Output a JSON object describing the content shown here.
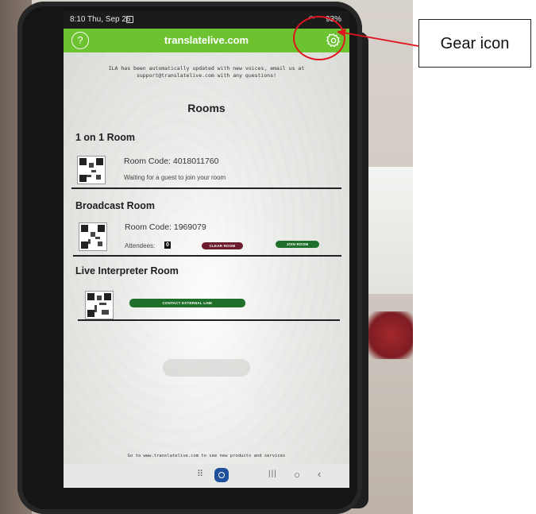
{
  "status_bar": {
    "time": "8:10",
    "date": "Thu, Sep 26",
    "battery": "93%"
  },
  "app_bar": {
    "title": "translatelive.com",
    "help_icon": "question-circle-icon",
    "gear_icon": "gear-icon"
  },
  "notice": {
    "line1": "ILA has been automatically updated with new voices, email us at",
    "line2": "support@translatelive.com with any questions!"
  },
  "rooms_heading": "Rooms",
  "one_on_one": {
    "title": "1 on 1 Room",
    "room_code": "Room Code: 4018011760",
    "status": "Waiting for a guest to join your room"
  },
  "broadcast": {
    "title": "Broadcast Room",
    "room_code": "Room Code: 1969079",
    "attendees_label": "Attendees:",
    "attendees_count": "0",
    "clear_button": "CLEAR ROOM",
    "join_button": "JOIN ROOM"
  },
  "interpreter": {
    "title": "Live Interpreter Room",
    "contact_button": "CONTACT EXTERNAL LINK"
  },
  "footer": "Go to www.translatelive.com to see new products and services",
  "annotation": {
    "label": "Gear icon"
  },
  "colors": {
    "app_bar_green": "#6cc22f",
    "clear_button": "#6b1b2a",
    "join_button": "#1f6e2a",
    "annotation_red": "#e0141e"
  }
}
